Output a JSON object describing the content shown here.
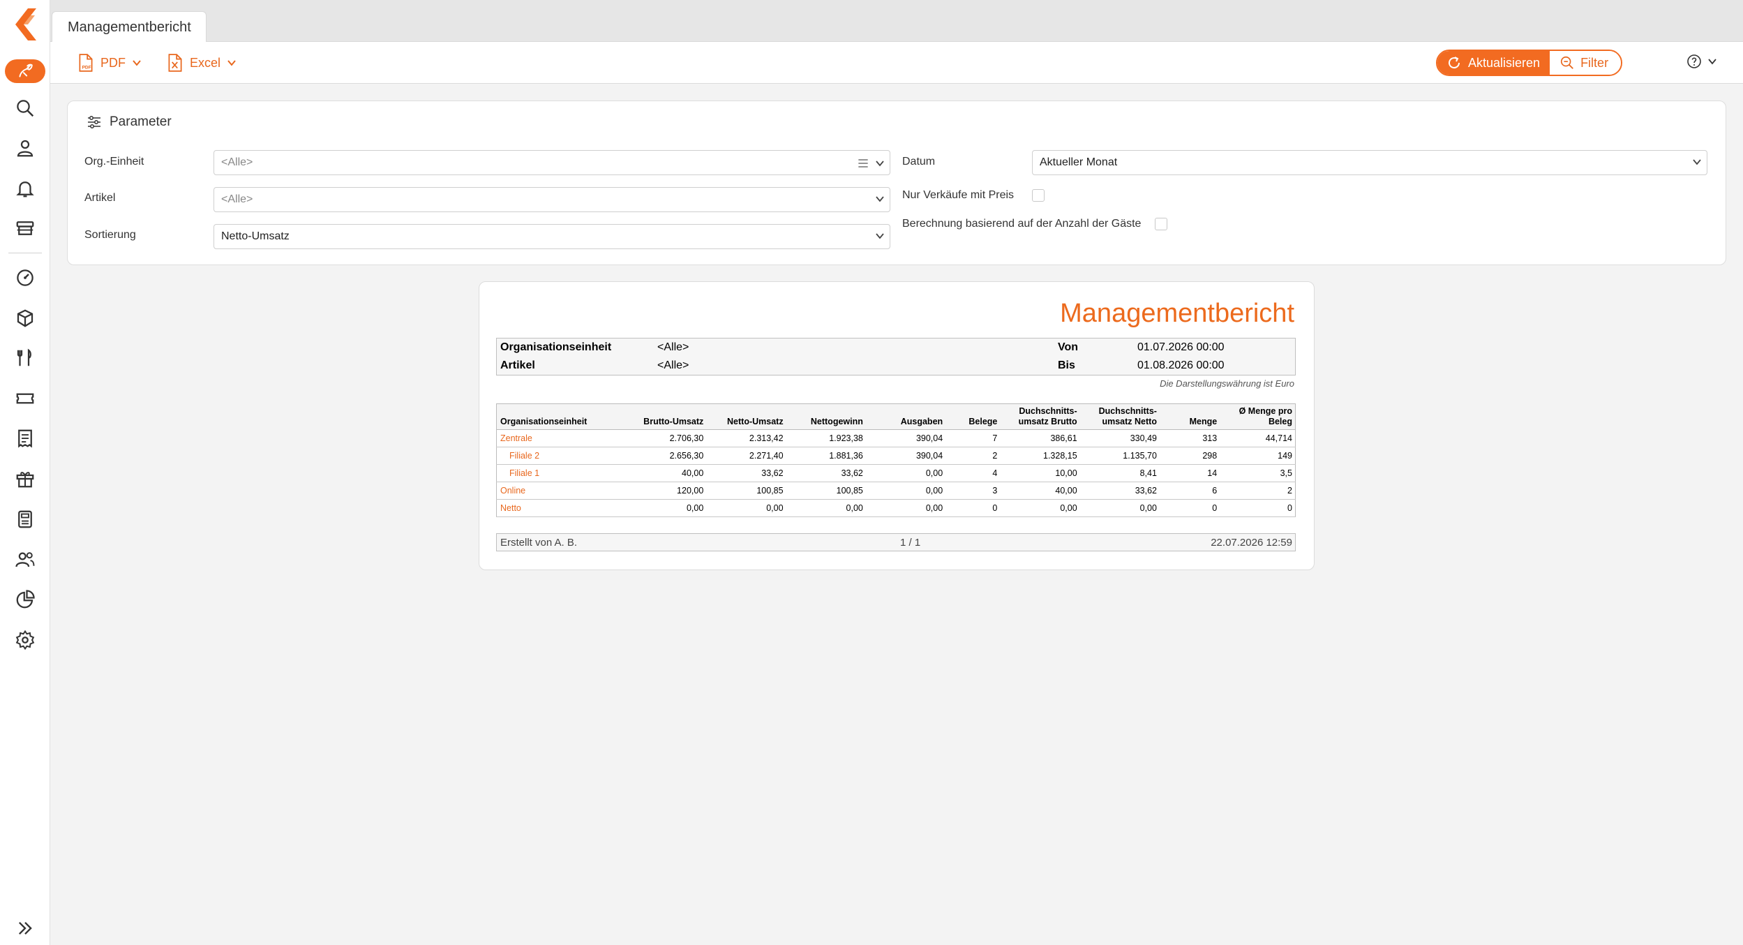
{
  "sidebar": {
    "logo": "brand-logo",
    "items": [
      {
        "name": "reports-icon",
        "active": true
      },
      {
        "name": "search-icon"
      },
      {
        "name": "user-icon"
      },
      {
        "name": "bell-icon"
      },
      {
        "name": "store-icon"
      },
      {
        "name": "dashboard-icon"
      },
      {
        "name": "products-icon"
      },
      {
        "name": "restaurant-icon"
      },
      {
        "name": "ticket-icon"
      },
      {
        "name": "receipt-icon"
      },
      {
        "name": "gift-icon"
      },
      {
        "name": "cash-register-icon"
      },
      {
        "name": "customers-icon"
      },
      {
        "name": "pie-chart-icon"
      },
      {
        "name": "settings-icon"
      }
    ],
    "expand": "double-chevron-right-icon"
  },
  "tab": {
    "label": "Managementbericht"
  },
  "toolbar": {
    "pdf_label": "PDF",
    "excel_label": "Excel",
    "refresh_label": "Aktualisieren",
    "filter_label": "Filter"
  },
  "params": {
    "title": "Parameter",
    "org_label": "Org.-Einheit",
    "org_value": "<Alle>",
    "article_label": "Artikel",
    "article_value": "<Alle>",
    "sort_label": "Sortierung",
    "sort_value": "Netto-Umsatz",
    "date_label": "Datum",
    "date_value": "Aktueller Monat",
    "only_sales_label": "Nur Verkäufe mit Preis",
    "guests_label": "Berechnung basierend auf der Anzahl der Gäste"
  },
  "report": {
    "title": "Managementbericht",
    "info": {
      "org_label": "Organisationseinheit",
      "org_value": "<Alle>",
      "article_label": "Artikel",
      "article_value": "<Alle>",
      "from_label": "Von",
      "from_value": "01.07.2026 00:00",
      "to_label": "Bis",
      "to_value": "01.08.2026 00:00"
    },
    "currency_note": "Die Darstellungswährung ist Euro",
    "columns": [
      "Organisationseinheit",
      "Brutto-Umsatz",
      "Netto-Umsatz",
      "Nettogewinn",
      "Ausgaben",
      "Belege",
      "Duchschnitts-\numsatz Brutto",
      "Duchschnitts-\numsatz Netto",
      "Menge",
      "Ø Menge pro\nBeleg"
    ],
    "rows": [
      {
        "org": "Zentrale",
        "sub": false,
        "values": [
          "2.706,30",
          "2.313,42",
          "1.923,38",
          "390,04",
          "7",
          "386,61",
          "330,49",
          "313",
          "44,714"
        ]
      },
      {
        "org": "Filiale 2",
        "sub": true,
        "values": [
          "2.656,30",
          "2.271,40",
          "1.881,36",
          "390,04",
          "2",
          "1.328,15",
          "1.135,70",
          "298",
          "149"
        ]
      },
      {
        "org": "Filiale 1",
        "sub": true,
        "values": [
          "40,00",
          "33,62",
          "33,62",
          "0,00",
          "4",
          "10,00",
          "8,41",
          "14",
          "3,5"
        ]
      },
      {
        "org": "Online",
        "sub": false,
        "values": [
          "120,00",
          "100,85",
          "100,85",
          "0,00",
          "3",
          "40,00",
          "33,62",
          "6",
          "2"
        ]
      },
      {
        "org": "Netto",
        "sub": false,
        "values": [
          "0,00",
          "0,00",
          "0,00",
          "0,00",
          "0",
          "0,00",
          "0,00",
          "0",
          "0"
        ]
      }
    ],
    "footer": {
      "created_by": "Erstellt von A. B.",
      "page": "1  /  1",
      "timestamp": "22.07.2026 12:59"
    }
  },
  "colors": {
    "accent": "#f26b21"
  }
}
